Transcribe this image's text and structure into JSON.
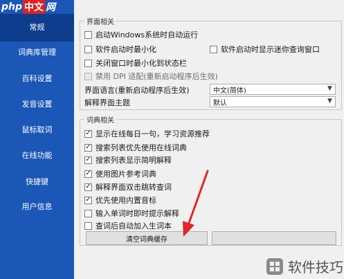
{
  "logo": {
    "part1": "php",
    "part2": "中文",
    "part3": "网"
  },
  "sidebar": {
    "items": [
      {
        "label": "常规",
        "active": true
      },
      {
        "label": "词典库管理"
      },
      {
        "label": "百科设置"
      },
      {
        "label": "发音设置"
      },
      {
        "label": "鼠标取词"
      },
      {
        "label": "在线功能"
      },
      {
        "label": "快捷键"
      },
      {
        "label": "用户信息"
      }
    ]
  },
  "ui_group": {
    "title": "界面相关",
    "options": [
      {
        "label": "启动Windows系统时自动运行",
        "checked": false
      },
      {
        "label": "软件启动时最小化",
        "checked": false
      },
      {
        "label": "软件启动时显示迷你查询窗口",
        "checked": false
      },
      {
        "label": "关闭窗口时最小化到状态栏",
        "checked": false
      },
      {
        "label": "禁用 DPI 适配(重新启动程序后生效)",
        "checked": false,
        "disabled": true
      }
    ],
    "language_label": "界面语言(重新启动程序后生效)",
    "language_value": "中文(简体)",
    "theme_label": "解释界面主题",
    "theme_value": "默认"
  },
  "dict_group": {
    "title": "词典相关",
    "options": [
      {
        "label": "显示在线每日一句，学习资源推荐",
        "checked": true
      },
      {
        "label": "搜索列表优先使用在线词典",
        "checked": true
      },
      {
        "label": "搜索列表显示简明解释",
        "checked": true
      },
      {
        "label": "使用图片参考词典",
        "checked": true
      },
      {
        "label": "解释界面双击跳转查词",
        "checked": true
      },
      {
        "label": "优先使用内置音标",
        "checked": true
      },
      {
        "label": "输入单词时即时提示解释",
        "checked": false
      },
      {
        "label": "查词后自动加入生词本",
        "checked": false
      }
    ],
    "clear_cache_button": "清空词典缓存",
    "second_button": ""
  },
  "watermark": {
    "text": "软件技巧"
  },
  "colors": {
    "sidebar": "#1a57b6",
    "sidebar_active": "#0d3d8c",
    "arrow": "#e0262a"
  }
}
